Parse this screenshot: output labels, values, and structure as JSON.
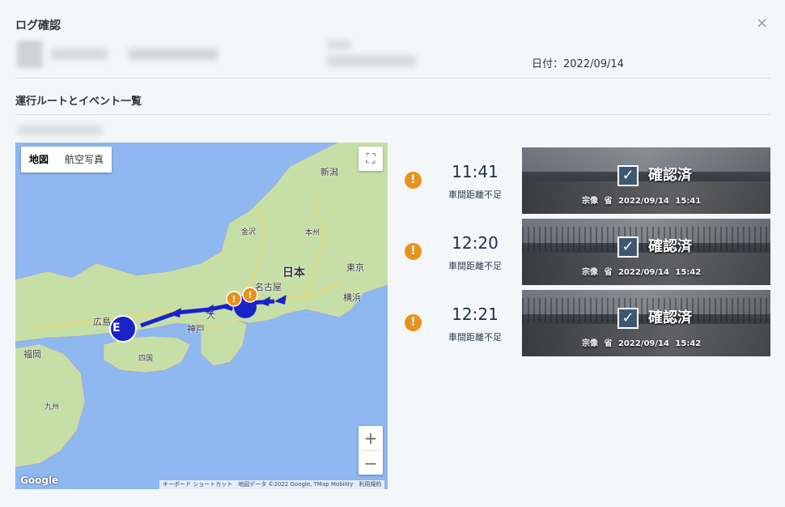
{
  "dialog": {
    "title": "ログ確認",
    "close_label": "×",
    "date_label": "日付：2022/09/14",
    "section_title": "運行ルートとイベント一覧"
  },
  "map": {
    "type_tabs": [
      "地図",
      "航空写真"
    ],
    "active_tab": "地図",
    "fullscreen_icon": "fullscreen-icon",
    "zoom_in": "+",
    "zoom_out": "−",
    "google_logo": "Google",
    "attribution": "キーボード ショートカット　地図データ ©2022 Google, TMap Mobility　利用規約",
    "places": {
      "niigata": "新潟",
      "kanazawa": "金沢",
      "honshu": "本州",
      "japan": "日本",
      "tokyo": "東京",
      "yokohama": "横浜",
      "nagoya": "名古屋",
      "kobe": "神戸",
      "osaka": "大",
      "hiroshima": "広島",
      "shikoku": "四国",
      "fukuoka": "福岡",
      "kyushu": "九州"
    },
    "end_marker": "E",
    "colors": {
      "route": "#1a23c9",
      "warning": "#e8921c",
      "sea": "#8fb7f0",
      "land": "#c5dfa6"
    }
  },
  "events": [
    {
      "time": "11:41",
      "type": "車間距離不足",
      "status": "確認済",
      "meta": "宗像 省 2022/09/14 15:41"
    },
    {
      "time": "12:20",
      "type": "車間距離不足",
      "status": "確認済",
      "meta": "宗像 省 2022/09/14 15:42"
    },
    {
      "time": "12:21",
      "type": "車間距離不足",
      "status": "確認済",
      "meta": "宗像 省 2022/09/14 15:42"
    }
  ]
}
